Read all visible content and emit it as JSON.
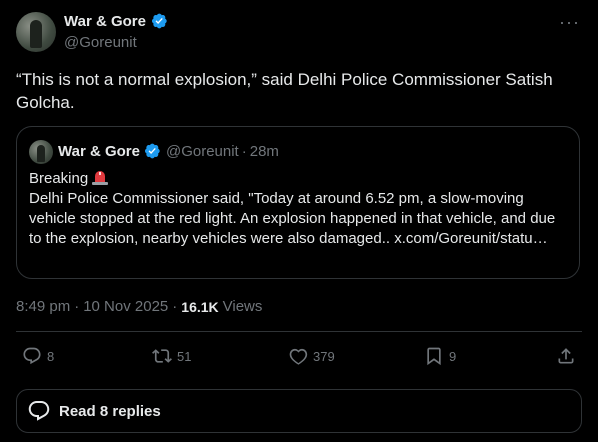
{
  "author": {
    "display_name": "War & Gore",
    "handle": "@Goreunit",
    "verified": true
  },
  "tweet": {
    "text": "“This is not a normal explosion,” said Delhi Police Commissioner Satish Golcha.",
    "time": "8:49 pm",
    "date": "10 Nov 2025",
    "views_count": "16.1K",
    "views_label": "Views"
  },
  "quote": {
    "display_name": "War & Gore",
    "handle": "@Goreunit",
    "age": "28m",
    "line1": "Breaking",
    "body": "Delhi Police Commissioner said, \"Today at around 6.52 pm, a slow-moving vehicle stopped at the red light. An explosion happened in that vehicle, and due to the explosion, nearby vehicles were also damaged.. x.com/Goreunit/statu…"
  },
  "actions": {
    "replies": "8",
    "reposts": "51",
    "likes": "379",
    "bookmarks": "9"
  },
  "replies_bar": {
    "label": "Read 8 replies"
  },
  "colors": {
    "background": "#000000",
    "text": "#e7e9ea",
    "muted": "#71767b",
    "verified": "#1d9bf0",
    "border": "#2f3336"
  }
}
